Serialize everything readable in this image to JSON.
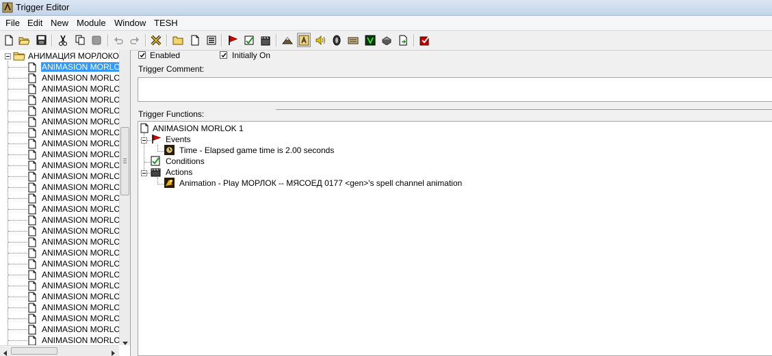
{
  "window": {
    "title": "Trigger Editor"
  },
  "menu": [
    "File",
    "Edit",
    "New",
    "Module",
    "Window",
    "TESH"
  ],
  "toolbar": [
    "new-icon",
    "open-icon",
    "save-icon",
    "cut-icon",
    "copy-icon",
    "paste-icon",
    "undo-icon",
    "redo-icon",
    "delete-icon",
    "new-category-icon",
    "new-trigger-icon",
    "new-comment-icon",
    "new-event-icon",
    "new-condition-icon",
    "new-action-icon",
    "terrain-editor-icon",
    "trigger-editor-icon",
    "sound-editor-icon",
    "object-editor-icon",
    "campaign-editor-icon",
    "ai-editor-icon",
    "object-manager-icon",
    "import-manager-icon",
    "test-map-icon"
  ],
  "tree": {
    "category": "АНИМАЦИЯ МОРЛОКОВ",
    "items": [
      "ANIMASION MORLOK",
      "ANIMASION MORLOK",
      "ANIMASION MORLOK",
      "ANIMASION MORLOK",
      "ANIMASION MORLOK",
      "ANIMASION MORLOK",
      "ANIMASION MORLOK",
      "ANIMASION MORLOK",
      "ANIMASION MORLOK",
      "ANIMASION MORLOK",
      "ANIMASION MORLOK",
      "ANIMASION MORLOK",
      "ANIMASION MORLOK",
      "ANIMASION MORLOK",
      "ANIMASION MORLOK",
      "ANIMASION MORLOK",
      "ANIMASION MORLOK",
      "ANIMASION MORLOK",
      "ANIMASION MORLOK",
      "ANIMASION MORLOK",
      "ANIMASION MORLOK",
      "ANIMASION MORLOK",
      "ANIMASION MORLOK",
      "ANIMASION MORLOK",
      "ANIMASION MORLOK",
      "ANIMASION MORLOK"
    ]
  },
  "trigger": {
    "enabled_label": "Enabled",
    "initially_on_label": "Initially On",
    "enabled": true,
    "initially_on": true,
    "comment_label": "Trigger Comment:",
    "comment": "",
    "functions_label": "Trigger Functions:",
    "name": "ANIMASION MORLOK 1",
    "events_label": "Events",
    "event": "Time - Elapsed game time is 2.00 seconds",
    "conditions_label": "Conditions",
    "actions_label": "Actions",
    "action": "Animation - Play МОРЛОК -- МЯСОЕД 0177 <gen>'s spell channel animation"
  }
}
